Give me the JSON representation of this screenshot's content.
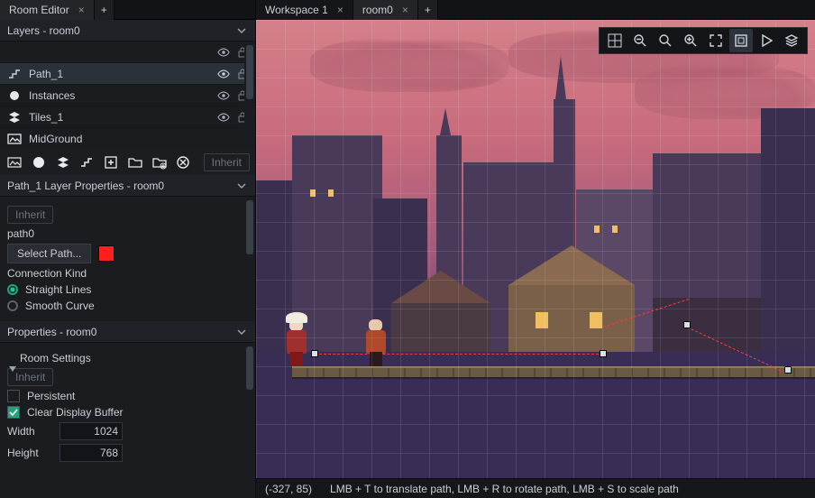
{
  "left_tabs": {
    "editor": "Room Editor",
    "add": "+"
  },
  "right_tabs": {
    "workspace": "Workspace 1",
    "room": "room0",
    "add": "+"
  },
  "layers": {
    "header": "Layers - room0",
    "items": [
      {
        "name": "Path_1",
        "selected": true
      },
      {
        "name": "Instances",
        "selected": false
      },
      {
        "name": "Tiles_1",
        "selected": false
      },
      {
        "name": "MidGround",
        "selected": false
      }
    ],
    "inherit": "Inherit"
  },
  "layer_props": {
    "header": "Path_1 Layer Properties - room0",
    "inherit": "Inherit",
    "path_name": "path0",
    "select_path": "Select Path...",
    "path_color": "#ff1f1f",
    "connection_label": "Connection Kind",
    "opt_straight": "Straight Lines",
    "opt_smooth": "Smooth Curve",
    "connection_selected": "straight"
  },
  "room_props": {
    "header": "Properties - room0",
    "settings_label": "Room Settings",
    "inherit": "Inherit",
    "persistent": "Persistent",
    "clear_buffer": "Clear Display Buffer",
    "width_label": "Width",
    "width": "1024",
    "height_label": "Height",
    "height": "768"
  },
  "status": {
    "coords": "(-327, 85)",
    "hint": "LMB + T to translate path, LMB + R to rotate path, LMB + S to scale path"
  }
}
